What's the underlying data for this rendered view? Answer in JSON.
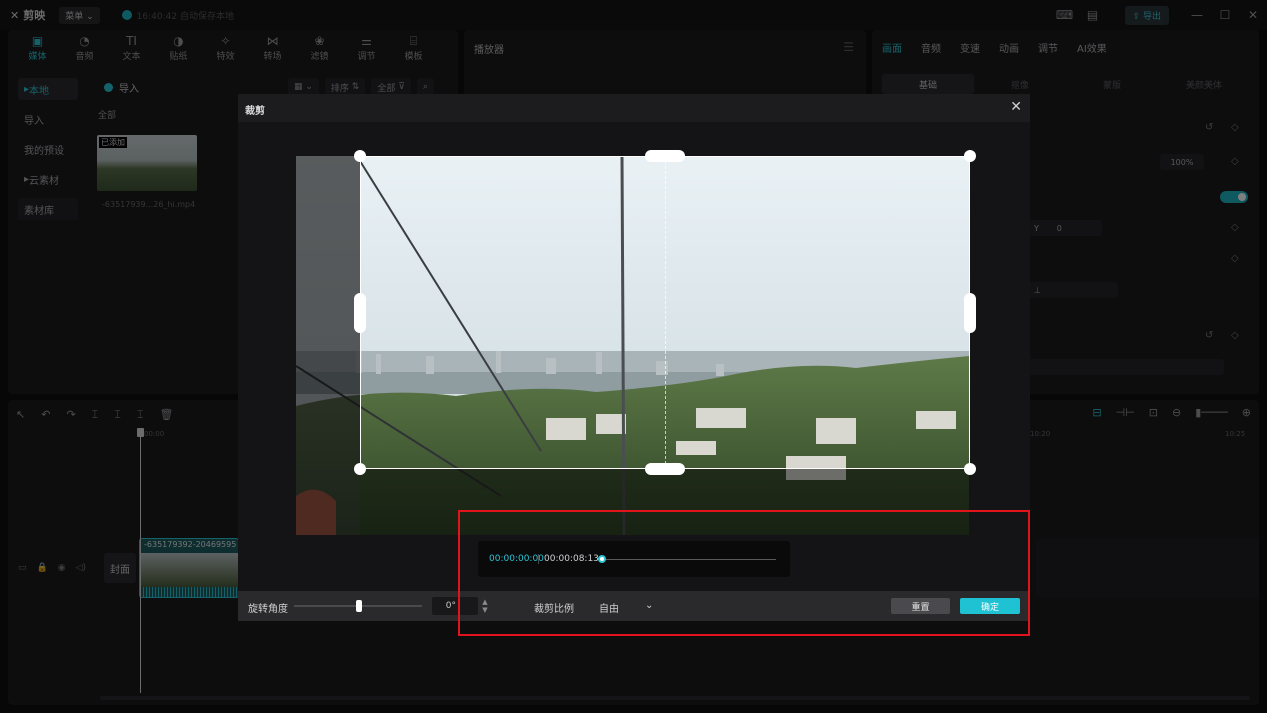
{
  "app": {
    "name": "剪映",
    "menu_label": "菜单",
    "save_status": "16:40:42 自动保存本地",
    "export_label": "导出"
  },
  "media_panel": {
    "tabs": [
      {
        "label": "媒体",
        "icon": "media-icon",
        "glyph": "▣"
      },
      {
        "label": "音频",
        "icon": "audio-icon",
        "glyph": "◔"
      },
      {
        "label": "文本",
        "icon": "text-icon",
        "glyph": "TI"
      },
      {
        "label": "贴纸",
        "icon": "sticker-icon",
        "glyph": "◑"
      },
      {
        "label": "特效",
        "icon": "effects-icon",
        "glyph": "✧"
      },
      {
        "label": "转场",
        "icon": "transition-icon",
        "glyph": "⋈"
      },
      {
        "label": "滤镜",
        "icon": "filter-icon",
        "glyph": "❀"
      },
      {
        "label": "调节",
        "icon": "adjust-icon",
        "glyph": "⚌"
      },
      {
        "label": "模板",
        "icon": "template-icon",
        "glyph": "⌸"
      }
    ],
    "side_items": [
      "本地",
      "导入",
      "我的预设",
      "云素材",
      "素材库"
    ],
    "import_label": "导入",
    "sort_label": "排序",
    "filter_label": "全部",
    "all_label": "全部",
    "thumb_badge": "已添加",
    "thumb_name": "-63517939...26_hi.mp4"
  },
  "player": {
    "title": "播放器"
  },
  "props": {
    "tabs": [
      "画面",
      "音频",
      "变速",
      "动画",
      "调节",
      "AI效果"
    ],
    "sub_tabs": [
      "基础",
      "抠像",
      "蒙版",
      "美颜美体"
    ],
    "scale_value": "100%",
    "y_label": "Y",
    "y_value": "0"
  },
  "timeline": {
    "time_start": "00:00",
    "time_mark": "10:20",
    "time_end": "10:25",
    "cover_label": "封面",
    "clip_name": "-635179392-20469595"
  },
  "crop_dialog": {
    "title": "裁剪",
    "current_time": "00:00:00:00",
    "total_time": "00:00:08:13",
    "rotation_label": "旋转角度",
    "rotation_value": "0°",
    "ratio_label": "裁剪比例",
    "ratio_value": "自由",
    "reset_label": "重置",
    "confirm_label": "确定"
  },
  "colors": {
    "accent": "#1fc2d3",
    "annotation": "#e0141a"
  }
}
